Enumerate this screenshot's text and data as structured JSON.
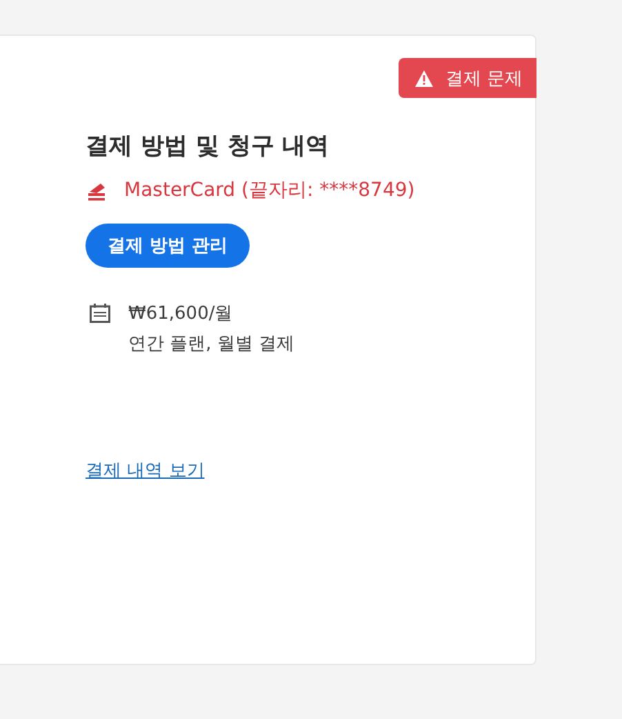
{
  "card": {
    "badge": {
      "kind": "warning",
      "label": "결제 문제"
    },
    "title": "결제 방법 및 청구 내역",
    "payment_method": {
      "error": true,
      "label": "MasterCard (끝자리: ****8749)"
    },
    "manage_button": "결제 방법 관리",
    "plan": {
      "price": "₩61,600/월",
      "description": "연간 플랜, 월별 결제"
    },
    "history_link": "결제 내역 보기"
  }
}
